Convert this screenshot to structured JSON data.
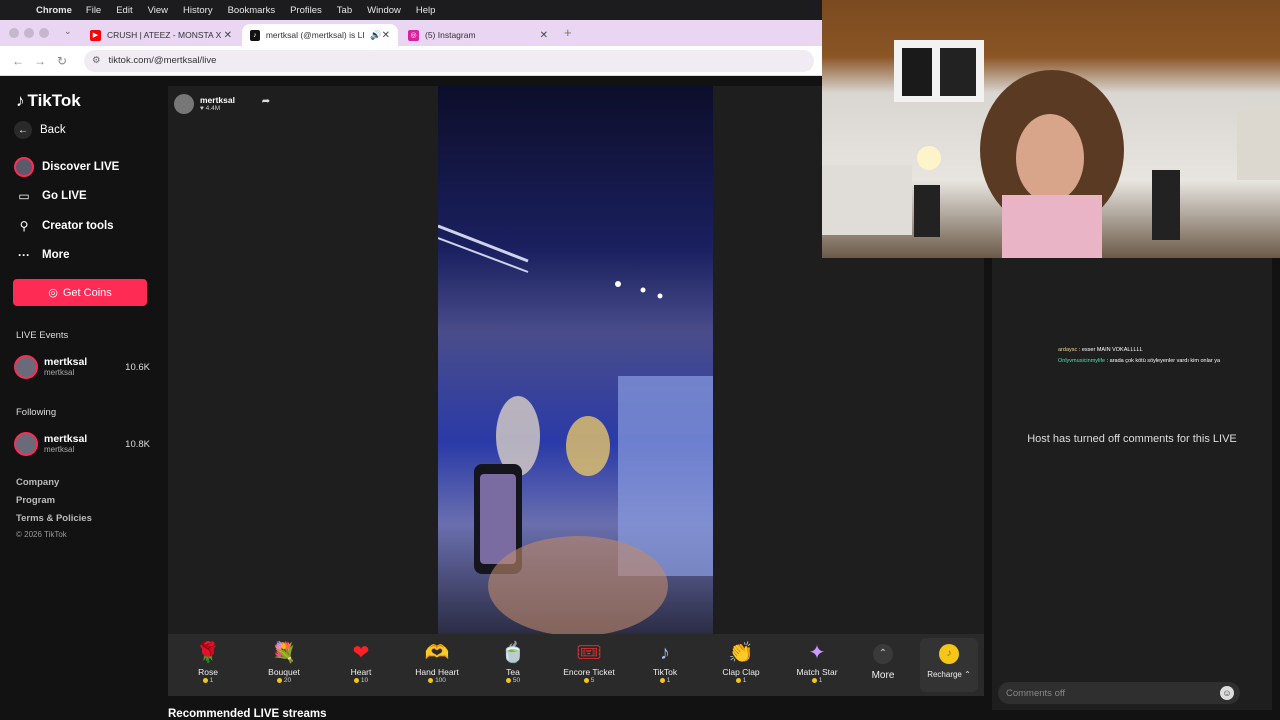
{
  "menubar": {
    "app": "Chrome",
    "items": [
      "File",
      "Edit",
      "View",
      "History",
      "Bookmarks",
      "Profiles",
      "Tab",
      "Window",
      "Help"
    ]
  },
  "browser": {
    "tabs": [
      {
        "title": "CRUSH | ATEEZ - MONSTA X",
        "favicon": "youtube-icon",
        "color": "#ff0000"
      },
      {
        "title": "mertksal (@mertksal) is LIVE",
        "favicon": "tiktok-icon",
        "color": "#111111"
      },
      {
        "title": "(5) Instagram",
        "favicon": "instagram-icon",
        "color": "#d6249f"
      }
    ],
    "url": "tiktok.com/@mertksal/live"
  },
  "sidebar": {
    "logo": "TikTok",
    "back": "Back",
    "nav": [
      "Discover LIVE",
      "Go LIVE",
      "Creator tools",
      "More"
    ],
    "get_coins": "Get Coins",
    "live_events_header": "LIVE Events",
    "live_events": [
      {
        "name": "mertksal",
        "handle": "mertksal",
        "viewers": "10.6K"
      }
    ],
    "following_header": "Following",
    "following": [
      {
        "name": "mertksal",
        "handle": "mertksal",
        "viewers": "10.8K"
      }
    ],
    "footer": [
      "Company",
      "Program",
      "Terms & Policies"
    ],
    "copyright": "© 2026 TikTok"
  },
  "stream": {
    "name": "mertksal",
    "likes": "4.4M"
  },
  "gifts": [
    {
      "name": "Rose",
      "price": "1",
      "glyph": "🌹"
    },
    {
      "name": "Bouquet",
      "price": "20",
      "glyph": "💐"
    },
    {
      "name": "Heart",
      "price": "10",
      "glyph": "❤"
    },
    {
      "name": "Hand Heart",
      "price": "100",
      "glyph": "🫶"
    },
    {
      "name": "Tea",
      "price": "50",
      "glyph": "🍵"
    },
    {
      "name": "Encore Ticket",
      "price": "5",
      "glyph": "🎟"
    },
    {
      "name": "TikTok",
      "price": "1",
      "glyph": "♪"
    },
    {
      "name": "Clap Clap",
      "price": "1",
      "glyph": "👏"
    },
    {
      "name": "Match Star",
      "price": "1",
      "glyph": "✦"
    }
  ],
  "gift_more": "More",
  "recharge": "Recharge",
  "recommended": "Recommended LIVE streams",
  "chat": {
    "lines": [
      {
        "user": "ardaysc",
        "text": "esser MAIN VOKALLLLL",
        "color": "#e8d98a"
      },
      {
        "user": "Onlyvmusicinmylife",
        "text": "arada çok kötü söyleyenler vardı kim onlar ya",
        "color": "#4ee0b0"
      }
    ],
    "comments_disabled": "Host has turned off comments for this LIVE",
    "input_placeholder": "Comments off"
  }
}
